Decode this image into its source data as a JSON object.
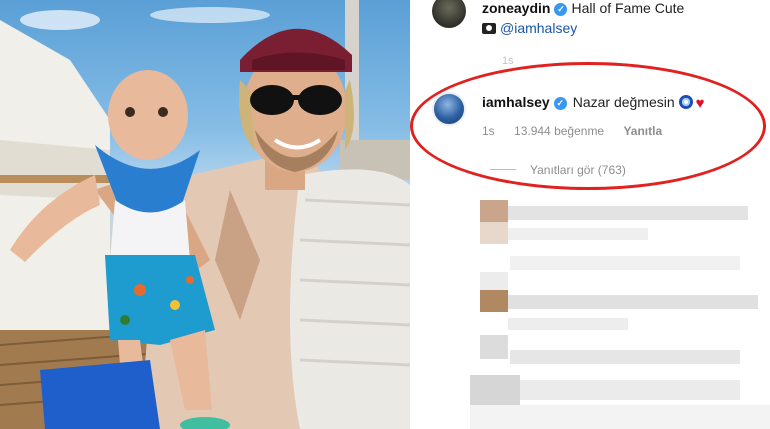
{
  "top_comment": {
    "username": "zoneaydin",
    "text": "Hall of Fame Cute",
    "mention": "@iamhalsey",
    "time": "1s",
    "avatar_icon": "avatar-icon",
    "verified_icon": "verified-badge-icon",
    "camera_icon": "camera-emoji-icon"
  },
  "highlighted_comment": {
    "username": "iamhalsey",
    "text": "Nazar değmesin",
    "time": "1s",
    "likes": "13.944 beğenme",
    "reply_label": "Yanıtla",
    "view_replies_label": "Yanıtları gör (763)",
    "emojis": [
      "nazar-boncugu-icon",
      "red-heart-icon"
    ],
    "ring_color": "#e0211f"
  },
  "colors": {
    "verified": "#3897f0",
    "mention": "#1a56a8",
    "meta_text": "#8e8e8e"
  }
}
